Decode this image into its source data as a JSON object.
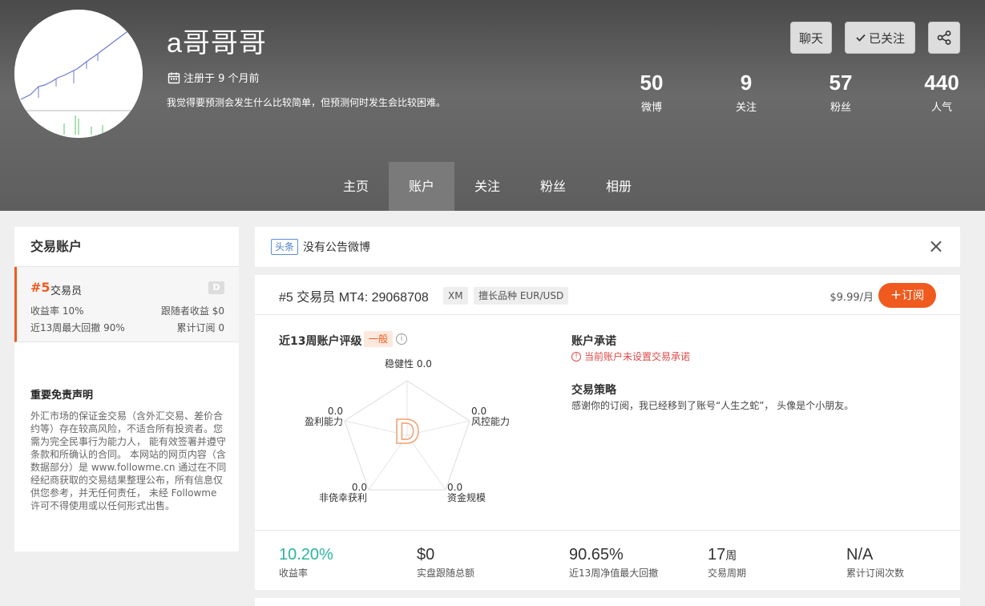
{
  "profile": {
    "username": "a哥哥哥",
    "registered": "注册于 9 个月前",
    "bio": "我觉得要预测会发生什么比较简单，但预测何时发生会比较困难。"
  },
  "header_buttons": {
    "chat": "聊天",
    "follow": "已关注"
  },
  "stats": [
    {
      "num": "50",
      "label": "微博"
    },
    {
      "num": "9",
      "label": "关注"
    },
    {
      "num": "57",
      "label": "粉丝"
    },
    {
      "num": "440",
      "label": "人气"
    }
  ],
  "nav": [
    {
      "label": "主页"
    },
    {
      "label": "账户"
    },
    {
      "label": "关注"
    },
    {
      "label": "粉丝"
    },
    {
      "label": "相册"
    }
  ],
  "sidebar": {
    "title": "交易账户",
    "account": {
      "rank": "#5",
      "role": "交易员",
      "grade": "D",
      "yield_label": "收益率 10%",
      "follower_profit": "跟随者收益 $0",
      "max_drawdown": "近13周最大回撤 90%",
      "subscriptions": "累计订阅 0"
    },
    "disclaimer_title": "重要免责声明",
    "disclaimer_text": "外汇市场的保证金交易（含外汇交易、差价合约等）存在较高风险，不适合所有投资者。您需为完全民事行为能力人， 能有效签署并遵守条款和所确认的合同。 本网站的网页内容（含数据部分）是 www.followme.cn 通过在不同经纪商获取的交易结果整理公布，所有信息仅供您参考，并无任何责任， 未经 Followme 许可不得使用或以任何形式出售。"
  },
  "announcement": {
    "tag": "头条",
    "text": "没有公告微博",
    "close": "×"
  },
  "account": {
    "rank": "#5",
    "title": "交易员 MT4: 29068708",
    "broker": "XM",
    "specialty": "擅长品种 EUR/USD",
    "price": "$9.99/月",
    "subscribe": "订阅",
    "rating_title": "近13周账户评级",
    "rating": "一般",
    "grade": "D",
    "radar": {
      "stability": {
        "label": "稳健性",
        "value": "0.0"
      },
      "risk": {
        "label": "风控能力",
        "value": "0.0"
      },
      "scale": {
        "label": "资金规模",
        "value": "0.0"
      },
      "luck": {
        "label": "非侥幸获利",
        "value": "0.0"
      },
      "profit": {
        "label": "盈利能力",
        "value": "0.0"
      }
    },
    "promise_title": "账户承诺",
    "promise_warning": "当前账户未设置交易承诺",
    "strategy_title": "交易策略",
    "strategy_text": "感谢你的订阅，我已经移到了账号“人生之蛇”， 头像是个小朋友。"
  },
  "metrics": [
    {
      "value": "10.20%",
      "label": "收益率"
    },
    {
      "value": "$0",
      "label": "实盘跟随总额"
    },
    {
      "value": "90.65%",
      "label": "近13周净值最大回撤"
    },
    {
      "value": "17",
      "unit": "周",
      "label": "交易周期"
    },
    {
      "value": "N/A",
      "label": "累计订阅次数"
    }
  ],
  "colors": {
    "accent": "#f05a1e",
    "green": "#2bb5a0",
    "warning": "#e04848"
  }
}
